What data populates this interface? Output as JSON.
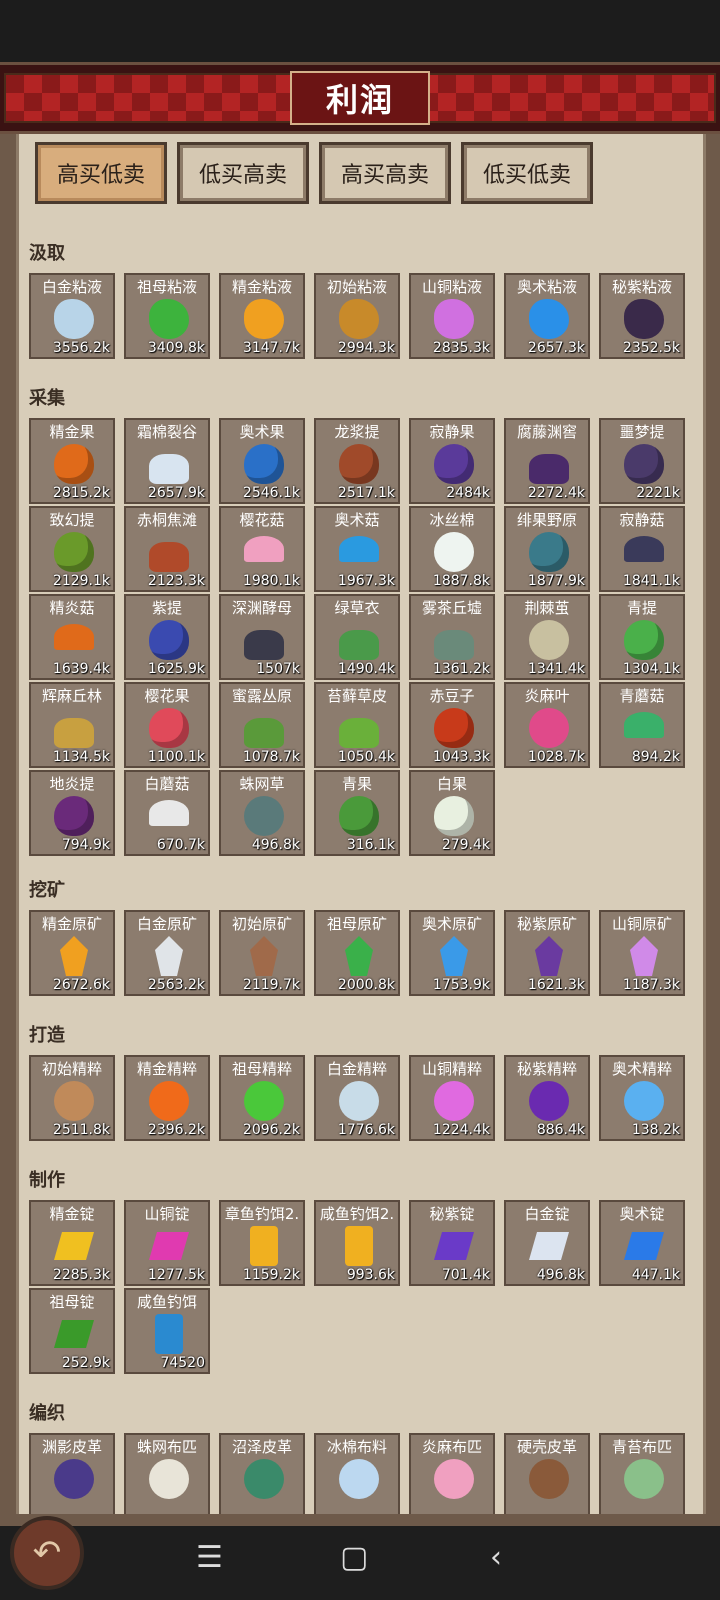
{
  "header": {
    "title": "利润"
  },
  "tabs": [
    {
      "label": "高买低卖",
      "active": true
    },
    {
      "label": "低买高卖",
      "active": false
    },
    {
      "label": "高买高卖",
      "active": false
    },
    {
      "label": "低买低卖",
      "active": false
    }
  ],
  "sections": [
    {
      "title": "汲取",
      "items": [
        {
          "name": "白金粘液",
          "value": "3556.2k",
          "icon": "platinum-slime-icon",
          "color": "#b8d4e8"
        },
        {
          "name": "祖母粘液",
          "value": "3409.8k",
          "icon": "emerald-slime-icon",
          "color": "#3db33d"
        },
        {
          "name": "精金粘液",
          "value": "3147.7k",
          "icon": "adamant-slime-icon",
          "color": "#f0a020"
        },
        {
          "name": "初始粘液",
          "value": "2994.3k",
          "icon": "origin-slime-icon",
          "color": "#c88a2a"
        },
        {
          "name": "山铜粘液",
          "value": "2835.3k",
          "icon": "orichalcum-slime-icon",
          "color": "#d070e0"
        },
        {
          "name": "奥术粘液",
          "value": "2657.3k",
          "icon": "arcane-slime-icon",
          "color": "#2a90e8"
        },
        {
          "name": "秘紫粘液",
          "value": "2352.5k",
          "icon": "mystic-purple-slime-icon",
          "color": "#3a2a4a"
        }
      ]
    },
    {
      "title": "采集",
      "items": [
        {
          "name": "精金果",
          "value": "2815.2k",
          "icon": "adamant-fruit-icon",
          "color": "#e06a1a"
        },
        {
          "name": "霜棉裂谷",
          "value": "2657.9k",
          "icon": "frost-cotton-rift-icon",
          "color": "#d8e4f0"
        },
        {
          "name": "奥术果",
          "value": "2546.1k",
          "icon": "arcane-fruit-icon",
          "color": "#2a70c8"
        },
        {
          "name": "龙浆提",
          "value": "2517.1k",
          "icon": "dragon-grape-icon",
          "color": "#a04a2a"
        },
        {
          "name": "寂静果",
          "value": "2484k",
          "icon": "silent-fruit-icon",
          "color": "#5a3a9a"
        },
        {
          "name": "腐藤渊窖",
          "value": "2272.4k",
          "icon": "rot-vine-cellar-icon",
          "color": "#4a2a6a"
        },
        {
          "name": "噩梦提",
          "value": "2221k",
          "icon": "nightmare-grape-icon",
          "color": "#4a3a6a"
        },
        {
          "name": "致幻提",
          "value": "2129.1k",
          "icon": "hallucinogen-grape-icon",
          "color": "#6a9a2a"
        },
        {
          "name": "赤桐焦滩",
          "value": "2123.3k",
          "icon": "red-tung-beach-icon",
          "color": "#b04a2a"
        },
        {
          "name": "樱花菇",
          "value": "1980.1k",
          "icon": "sakura-mushroom-icon",
          "color": "#f0a0c0"
        },
        {
          "name": "奥术菇",
          "value": "1967.3k",
          "icon": "arcane-mushroom-icon",
          "color": "#2a9ae0"
        },
        {
          "name": "冰丝棉",
          "value": "1887.8k",
          "icon": "ice-silk-cotton-icon",
          "color": "#eef4f0"
        },
        {
          "name": "绯果野原",
          "value": "1877.9k",
          "icon": "scarlet-fruit-field-icon",
          "color": "#3a7a8a"
        },
        {
          "name": "寂静菇",
          "value": "1841.1k",
          "icon": "silent-mushroom-icon",
          "color": "#3a3a5a"
        },
        {
          "name": "精炎菇",
          "value": "1639.4k",
          "icon": "flame-mushroom-icon",
          "color": "#e06a1a"
        },
        {
          "name": "紫提",
          "value": "1625.9k",
          "icon": "purple-grape-icon",
          "color": "#3a4ab0"
        },
        {
          "name": "深渊酵母",
          "value": "1507k",
          "icon": "abyss-yeast-icon",
          "color": "#3a3a4a"
        },
        {
          "name": "绿草衣",
          "value": "1490.4k",
          "icon": "green-grass-coat-icon",
          "color": "#4a9a4a"
        },
        {
          "name": "雾茶丘墟",
          "value": "1361.2k",
          "icon": "mist-tea-hill-icon",
          "color": "#6a8a7a"
        },
        {
          "name": "荆棘茧",
          "value": "1341.4k",
          "icon": "thorn-cocoon-icon",
          "color": "#c8c0a0"
        },
        {
          "name": "青提",
          "value": "1304.1k",
          "icon": "green-grape-icon",
          "color": "#4ab04a"
        },
        {
          "name": "辉麻丘林",
          "value": "1134.5k",
          "icon": "glow-hemp-hill-icon",
          "color": "#c8a040"
        },
        {
          "name": "樱花果",
          "value": "1100.1k",
          "icon": "sakura-fruit-icon",
          "color": "#e04a5a"
        },
        {
          "name": "蜜露丛原",
          "value": "1078.7k",
          "icon": "honeydew-field-icon",
          "color": "#5a9a3a"
        },
        {
          "name": "苔藓草皮",
          "value": "1050.4k",
          "icon": "moss-turf-icon",
          "color": "#6ab03a"
        },
        {
          "name": "赤豆子",
          "value": "1043.3k",
          "icon": "red-bean-icon",
          "color": "#c83a1a"
        },
        {
          "name": "炎麻叶",
          "value": "1028.7k",
          "icon": "flame-hemp-leaf-icon",
          "color": "#e04a8a"
        },
        {
          "name": "青蘑菇",
          "value": "894.2k",
          "icon": "green-mushroom-icon",
          "color": "#3ab06a"
        },
        {
          "name": "地炎提",
          "value": "794.9k",
          "icon": "earth-flame-grape-icon",
          "color": "#6a2a7a"
        },
        {
          "name": "白蘑菇",
          "value": "670.7k",
          "icon": "white-mushroom-icon",
          "color": "#e8e8e8"
        },
        {
          "name": "蛛网草",
          "value": "496.8k",
          "icon": "cobweb-grass-icon",
          "color": "#5a7a7a"
        },
        {
          "name": "青果",
          "value": "316.1k",
          "icon": "green-fruit-icon",
          "color": "#4a9a3a"
        },
        {
          "name": "白果",
          "value": "279.4k",
          "icon": "white-fruit-icon",
          "color": "#e8f0e0"
        }
      ]
    },
    {
      "title": "挖矿",
      "items": [
        {
          "name": "精金原矿",
          "value": "2672.6k",
          "icon": "adamant-ore-icon",
          "color": "#f0a020"
        },
        {
          "name": "白金原矿",
          "value": "2563.2k",
          "icon": "platinum-ore-icon",
          "color": "#e0e4e8"
        },
        {
          "name": "初始原矿",
          "value": "2119.7k",
          "icon": "origin-ore-icon",
          "color": "#a06a4a"
        },
        {
          "name": "祖母原矿",
          "value": "2000.8k",
          "icon": "emerald-ore-icon",
          "color": "#3ab04a"
        },
        {
          "name": "奥术原矿",
          "value": "1753.9k",
          "icon": "arcane-ore-icon",
          "color": "#3a9ae8"
        },
        {
          "name": "秘紫原矿",
          "value": "1621.3k",
          "icon": "mystic-purple-ore-icon",
          "color": "#6a3aa0"
        },
        {
          "name": "山铜原矿",
          "value": "1187.3k",
          "icon": "orichalcum-ore-icon",
          "color": "#d08ae8"
        }
      ]
    },
    {
      "title": "打造",
      "items": [
        {
          "name": "初始精粹",
          "value": "2511.8k",
          "icon": "origin-essence-icon",
          "color": "#c08a5a"
        },
        {
          "name": "精金精粹",
          "value": "2396.2k",
          "icon": "adamant-essence-icon",
          "color": "#f06a1a"
        },
        {
          "name": "祖母精粹",
          "value": "2096.2k",
          "icon": "emerald-essence-icon",
          "color": "#4ac83a"
        },
        {
          "name": "白金精粹",
          "value": "1776.6k",
          "icon": "platinum-essence-icon",
          "color": "#c8dce8"
        },
        {
          "name": "山铜精粹",
          "value": "1224.4k",
          "icon": "orichalcum-essence-icon",
          "color": "#e06ae0"
        },
        {
          "name": "秘紫精粹",
          "value": "886.4k",
          "icon": "mystic-purple-essence-icon",
          "color": "#6a2ab0"
        },
        {
          "name": "奥术精粹",
          "value": "138.2k",
          "icon": "arcane-essence-icon",
          "color": "#5ab0f0"
        }
      ]
    },
    {
      "title": "制作",
      "items": [
        {
          "name": "精金锭",
          "value": "2285.3k",
          "icon": "adamant-ingot-icon",
          "color": "#f0c020"
        },
        {
          "name": "山铜锭",
          "value": "1277.5k",
          "icon": "orichalcum-ingot-icon",
          "color": "#e03ab0"
        },
        {
          "name": "章鱼钓饵2.",
          "value": "1159.2k",
          "icon": "octopus-bait-icon",
          "color": "#f0b020"
        },
        {
          "name": "咸鱼钓饵2.",
          "value": "993.6k",
          "icon": "salted-fish-bait-icon",
          "color": "#f0b020"
        },
        {
          "name": "秘紫锭",
          "value": "701.4k",
          "icon": "mystic-purple-ingot-icon",
          "color": "#6a3ac8"
        },
        {
          "name": "白金锭",
          "value": "496.8k",
          "icon": "platinum-ingot-icon",
          "color": "#dce4f0"
        },
        {
          "name": "奥术锭",
          "value": "447.1k",
          "icon": "arcane-ingot-icon",
          "color": "#2a7ae8"
        },
        {
          "name": "祖母锭",
          "value": "252.9k",
          "icon": "emerald-ingot-icon",
          "color": "#3a9a2a"
        },
        {
          "name": "咸鱼钓饵",
          "value": "74520",
          "icon": "salted-fish-bait-can-icon",
          "color": "#2a8ad0"
        }
      ]
    },
    {
      "title": "编织",
      "items": [
        {
          "name": "渊影皮革",
          "value": "",
          "icon": "abyss-shadow-leather-icon",
          "color": "#4a3a8a"
        },
        {
          "name": "蛛网布匹",
          "value": "",
          "icon": "cobweb-cloth-icon",
          "color": "#e8e4d8"
        },
        {
          "name": "沼泽皮革",
          "value": "",
          "icon": "swamp-leather-icon",
          "color": "#3a8a6a"
        },
        {
          "name": "冰棉布料",
          "value": "",
          "icon": "ice-cotton-cloth-icon",
          "color": "#bcd8f0"
        },
        {
          "name": "炎麻布匹",
          "value": "",
          "icon": "flame-hemp-cloth-icon",
          "color": "#f0a0c0"
        },
        {
          "name": "硬壳皮革",
          "value": "",
          "icon": "hard-shell-leather-icon",
          "color": "#8a5a3a"
        },
        {
          "name": "青苔布匹",
          "value": "",
          "icon": "moss-cloth-icon",
          "color": "#8ac08a"
        }
      ]
    }
  ]
}
